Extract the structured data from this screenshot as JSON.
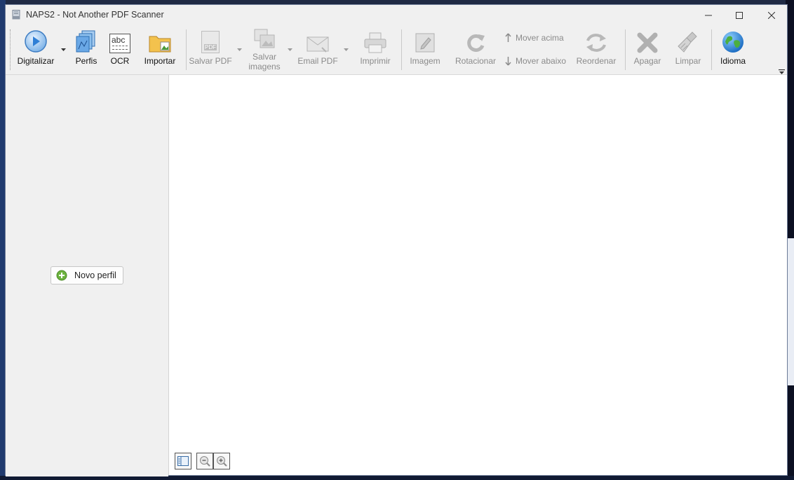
{
  "window": {
    "title": "NAPS2 - Not Another PDF Scanner",
    "controls": {
      "minimize": "minimize-icon",
      "maximize": "maximize-icon",
      "close": "close-icon"
    }
  },
  "toolbar": {
    "scan": {
      "label": "Digitalizar",
      "icon": "scan-play-icon",
      "enabled": true,
      "has_dropdown": true
    },
    "profiles": {
      "label": "Perfis",
      "icon": "profiles-icon",
      "enabled": true
    },
    "ocr": {
      "label": "OCR",
      "icon_text": "abc",
      "icon": "ocr-icon",
      "enabled": true
    },
    "import": {
      "label": "Importar",
      "icon": "import-folder-icon",
      "enabled": true
    },
    "save_pdf": {
      "label": "Salvar PDF",
      "icon_text": "PDF",
      "icon": "pdf-file-icon",
      "enabled": false,
      "has_dropdown": true
    },
    "save_images": {
      "label_line1": "Salvar",
      "label_line2": "imagens",
      "icon": "images-icon",
      "enabled": false,
      "has_dropdown": true
    },
    "email_pdf": {
      "label": "Email PDF",
      "icon": "email-icon",
      "enabled": false,
      "has_dropdown": true
    },
    "print": {
      "label": "Imprimir",
      "icon": "printer-icon",
      "enabled": false
    },
    "image": {
      "label": "Imagem",
      "icon": "image-edit-icon",
      "enabled": false
    },
    "rotate": {
      "label": "Rotacionar",
      "icon": "rotate-icon",
      "enabled": false
    },
    "move_up": {
      "label": "Mover acima",
      "icon": "arrow-up-icon",
      "enabled": false
    },
    "move_down": {
      "label": "Mover abaixo",
      "icon": "arrow-down-icon",
      "enabled": false
    },
    "reorder": {
      "label": "Reordenar",
      "icon": "reorder-icon",
      "enabled": false
    },
    "delete": {
      "label": "Apagar",
      "icon": "delete-x-icon",
      "enabled": false
    },
    "clear": {
      "label": "Limpar",
      "icon": "broom-icon",
      "enabled": false
    },
    "language": {
      "label": "Idioma",
      "icon": "globe-icon",
      "enabled": true
    }
  },
  "left_panel": {
    "new_profile": {
      "label": "Novo perfil",
      "icon": "plus-circle-icon"
    }
  },
  "main_panel": {
    "bottom_buttons": [
      "layout-toggle-icon",
      "zoom-out-icon",
      "zoom-in-icon"
    ]
  },
  "colors": {
    "window_bg": "#f0f0f0",
    "main_bg": "#ffffff",
    "accent_blue": "#2f7fd6",
    "disabled_text": "#8b8b8b"
  }
}
